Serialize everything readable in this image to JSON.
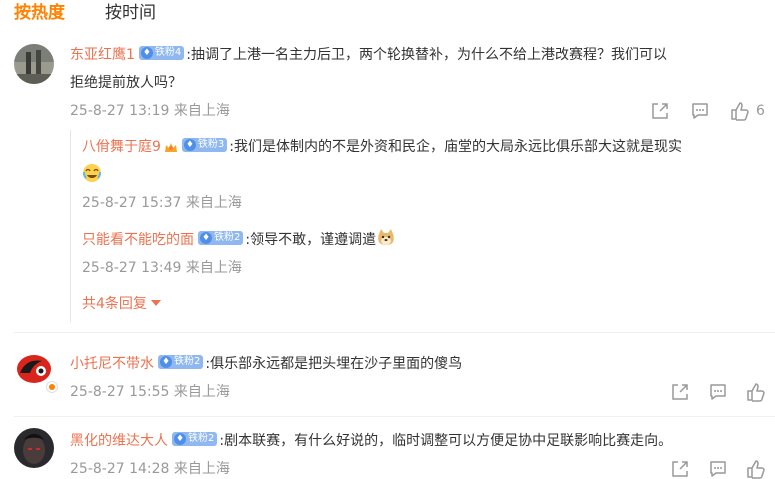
{
  "tabs": [
    {
      "label": "按热度",
      "active": true
    },
    {
      "label": "按时间",
      "active": false
    }
  ],
  "colors": {
    "accent": "#ff8200",
    "username": "#eb7350",
    "meta": "#999999",
    "badge": "#8fb7f0"
  },
  "comments": [
    {
      "user": "东亚红鹰1",
      "badge": "铁粉4",
      "text_line1": ":抽调了上港一名主力后卫，两个轮换替补，为什么不给上港改赛程？我们可以",
      "text_line2": "拒绝提前放人吗？",
      "meta": "25-8-27 13:19 来自上海",
      "likes": "6",
      "replies": [
        {
          "user": "八佾舞于庭9",
          "badge": "铁粉3",
          "text": ":我们是体制内的不是外资和民企，庙堂的大局永远比俱乐部大这就是现实",
          "emoji": "laugh-cry-emoji",
          "meta": "25-8-27 15:37 来自上海"
        },
        {
          "user": "只能看不能吃的面",
          "badge": "铁粉2",
          "text": ":领导不敢，谨遵调遣",
          "emoji": "doge-emoji",
          "meta": "25-8-27 13:49 来自上海"
        }
      ],
      "more_replies": "共4条回复"
    },
    {
      "user": "小托尼不带水",
      "badge": "铁粉2",
      "text": ":俱乐部永远都是把头埋在沙子里面的傻鸟",
      "meta": "25-8-27 15:55 来自上海"
    },
    {
      "user": "黑化的维达大人",
      "badge": "铁粉2",
      "text": ":剧本联赛，有什么好说的，临时调整可以方便足协中足联影响比赛走向。",
      "meta": "25-8-27 14:28 来自上海"
    }
  ],
  "icons": {
    "share": "share-icon",
    "comment": "comment-icon",
    "like": "thumbs-up-icon"
  }
}
